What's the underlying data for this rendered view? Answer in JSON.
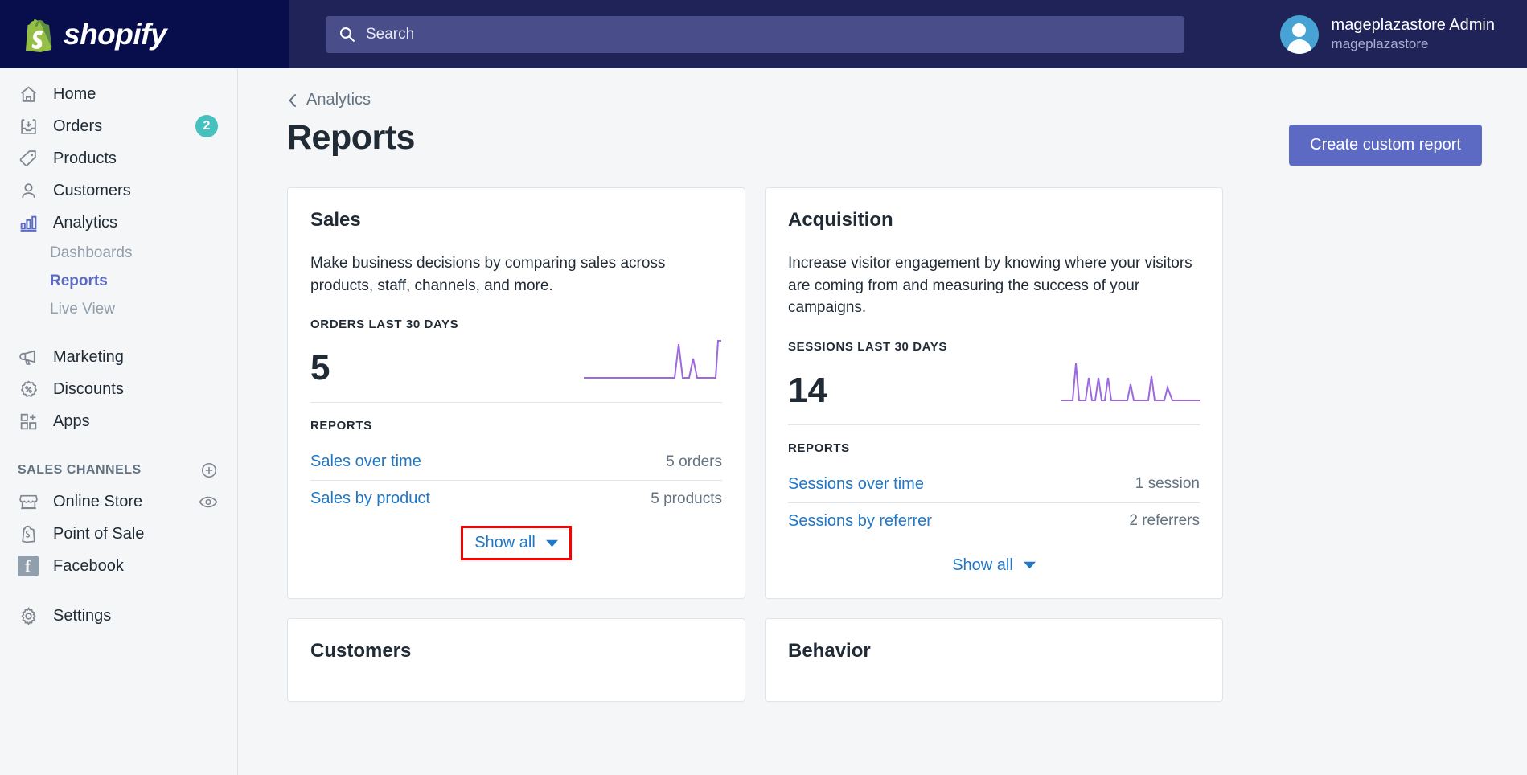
{
  "topbar": {
    "brand": "shopify",
    "brand_icon": "shopify-bag-icon",
    "search": {
      "placeholder": "Search",
      "value": "",
      "icon": "search-icon"
    },
    "user": {
      "name": "mageplazastore Admin",
      "store": "mageplazastore",
      "avatar_icon": "user-avatar-icon"
    }
  },
  "sidebar": {
    "items": [
      {
        "label": "Home",
        "icon": "home-icon",
        "badge": "",
        "active": false
      },
      {
        "label": "Orders",
        "icon": "orders-inbox-icon",
        "badge": "2",
        "active": false
      },
      {
        "label": "Products",
        "icon": "product-tag-icon",
        "badge": "",
        "active": false
      },
      {
        "label": "Customers",
        "icon": "customer-person-icon",
        "badge": "",
        "active": false
      },
      {
        "label": "Analytics",
        "icon": "analytics-bar-chart-icon",
        "badge": "",
        "active": true
      }
    ],
    "analytics_children": [
      {
        "label": "Dashboards",
        "active": false
      },
      {
        "label": "Reports",
        "active": true
      },
      {
        "label": "Live View",
        "active": false
      }
    ],
    "items2": [
      {
        "label": "Marketing",
        "icon": "megaphone-icon"
      },
      {
        "label": "Discounts",
        "icon": "discount-percent-icon"
      },
      {
        "label": "Apps",
        "icon": "apps-grid-plus-icon"
      }
    ],
    "sales_channels": {
      "title": "SALES CHANNELS",
      "add_icon": "plus-circle-icon",
      "items": [
        {
          "label": "Online Store",
          "icon": "storefront-icon",
          "trailing_icon": "eye-icon"
        },
        {
          "label": "Point of Sale",
          "icon": "pos-bag-icon",
          "trailing_icon": ""
        },
        {
          "label": "Facebook",
          "icon": "facebook-icon",
          "trailing_icon": ""
        }
      ]
    },
    "settings": {
      "label": "Settings",
      "icon": "gear-icon"
    }
  },
  "main": {
    "breadcrumb": {
      "label": "Analytics",
      "icon": "chevron-left-icon"
    },
    "page_title": "Reports",
    "create_button": "Create custom report",
    "cards": [
      {
        "title": "Sales",
        "description": "Make business decisions by comparing sales across products, staff, channels, and more.",
        "metric_label": "ORDERS LAST 30 DAYS",
        "metric_value": "5",
        "reports_label": "REPORTS",
        "reports": [
          {
            "name": "Sales over time",
            "count": "5 orders"
          },
          {
            "name": "Sales by product",
            "count": "5 products"
          }
        ],
        "show_all": "Show all",
        "highlighted": true
      },
      {
        "title": "Acquisition",
        "description": "Increase visitor engagement by knowing where your visitors are coming from and measuring the success of your campaigns.",
        "metric_label": "SESSIONS LAST 30 DAYS",
        "metric_value": "14",
        "reports_label": "REPORTS",
        "reports": [
          {
            "name": "Sessions over time",
            "count": "1 session"
          },
          {
            "name": "Sessions by referrer",
            "count": "2 referrers"
          }
        ],
        "show_all": "Show all",
        "highlighted": false
      },
      {
        "title": "Customers"
      },
      {
        "title": "Behavior"
      }
    ]
  },
  "chart_data": [
    {
      "type": "line",
      "title": "Orders last 30 days sparkline",
      "x": [
        0,
        1,
        2,
        3,
        4,
        5,
        6,
        7,
        8,
        9,
        10,
        11,
        12,
        13,
        14,
        15,
        16,
        17,
        18,
        19,
        20,
        21,
        22,
        23,
        24,
        25,
        26,
        27,
        28,
        29
      ],
      "values": [
        0,
        0,
        0,
        0,
        0,
        0,
        0,
        0,
        0,
        0,
        0,
        0,
        0,
        0,
        0,
        0,
        0,
        0,
        0,
        0,
        0,
        0,
        1,
        0,
        0,
        1,
        0,
        0,
        0,
        1
      ],
      "ylim": [
        0,
        1
      ],
      "color": "#9c6ade",
      "grid": false,
      "legend": false
    },
    {
      "type": "line",
      "title": "Sessions last 30 days sparkline",
      "x": [
        0,
        1,
        2,
        3,
        4,
        5,
        6,
        7,
        8,
        9,
        10,
        11,
        12,
        13,
        14,
        15,
        16,
        17,
        18,
        19,
        20,
        21,
        22,
        23,
        24,
        25,
        26,
        27,
        28,
        29
      ],
      "values": [
        0,
        0,
        0,
        3,
        0,
        0,
        1,
        0,
        1,
        0,
        1,
        0,
        0,
        1,
        0,
        0,
        0,
        1,
        0,
        0,
        1,
        0,
        1,
        0,
        0,
        0,
        0,
        0,
        0,
        0
      ],
      "ylim": [
        0,
        3
      ],
      "color": "#9c6ade",
      "grid": false,
      "legend": false
    }
  ],
  "colors": {
    "brand_navy": "#070e4b",
    "topbar": "#1f2357",
    "accent_indigo": "#5c6ac4",
    "link_blue": "#2077c5",
    "badge_teal": "#47c1bf",
    "sparkline_purple": "#9c6ade",
    "highlight_red": "#ff0000"
  }
}
